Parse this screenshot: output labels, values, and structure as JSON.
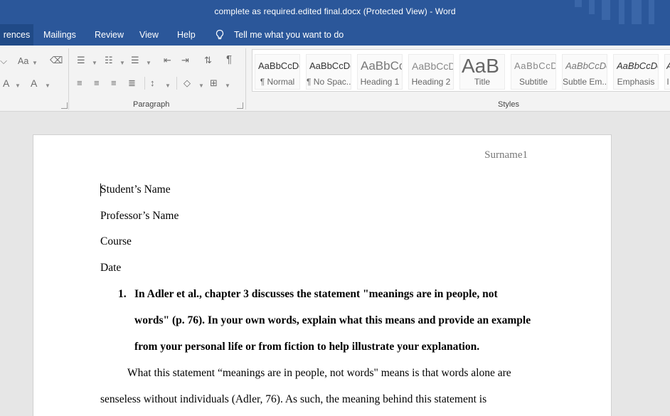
{
  "window": {
    "title": "complete as required.edited final.docx (Protected View)  -  Word"
  },
  "tabs": [
    {
      "label": "rences",
      "active": true
    },
    {
      "label": "Mailings"
    },
    {
      "label": "Review"
    },
    {
      "label": "View"
    },
    {
      "label": "Help"
    }
  ],
  "tell_me": {
    "label": "Tell me what you want to do",
    "icon": "lightbulb-icon"
  },
  "ribbon": {
    "paragraph_label": "Paragraph",
    "styles_label": "Styles",
    "font_glyphs": {
      "change_case": "Aa",
      "font_color": "A",
      "text_effects": "A"
    },
    "show_marks_glyph": "¶"
  },
  "styles": [
    {
      "sample": "AaBbCcDc",
      "name": "¶ Normal"
    },
    {
      "sample": "AaBbCcDc",
      "name": "¶ No Spac..."
    },
    {
      "sample": "AaBbCc",
      "name": "Heading 1"
    },
    {
      "sample": "AaBbCcD",
      "name": "Heading 2"
    },
    {
      "sample": "AaB",
      "name": "Title"
    },
    {
      "sample": "AaBbCcD",
      "name": "Subtitle"
    },
    {
      "sample": "AaBbCcDc",
      "name": "Subtle Em..."
    },
    {
      "sample": "AaBbCcDc",
      "name": "Emphasis"
    },
    {
      "sample": "A",
      "name": "I"
    }
  ],
  "document": {
    "header": "Surname1",
    "student_name": "Student’s Name",
    "professor_name": "Professor’s Name",
    "course": "Course",
    "date": "Date",
    "question_number": "1.",
    "question_lines": [
      "In Adler et al., chapter 3 discusses the statement \"meanings are in people, not",
      "words\" (p. 76). In your own words, explain what this means and provide an example",
      "from your personal life or from fiction to help illustrate your explanation."
    ],
    "body_lines": [
      "What this statement “meanings are in people, not words\" means is that words alone are",
      "senseless without individuals (Adler, 76). As such, the meaning behind this statement is"
    ]
  },
  "colors": {
    "title_bar": "#2b579a",
    "active_tab": "#204a87",
    "ribbon": "#f3f3f3",
    "canvas": "#e6e6e6"
  }
}
